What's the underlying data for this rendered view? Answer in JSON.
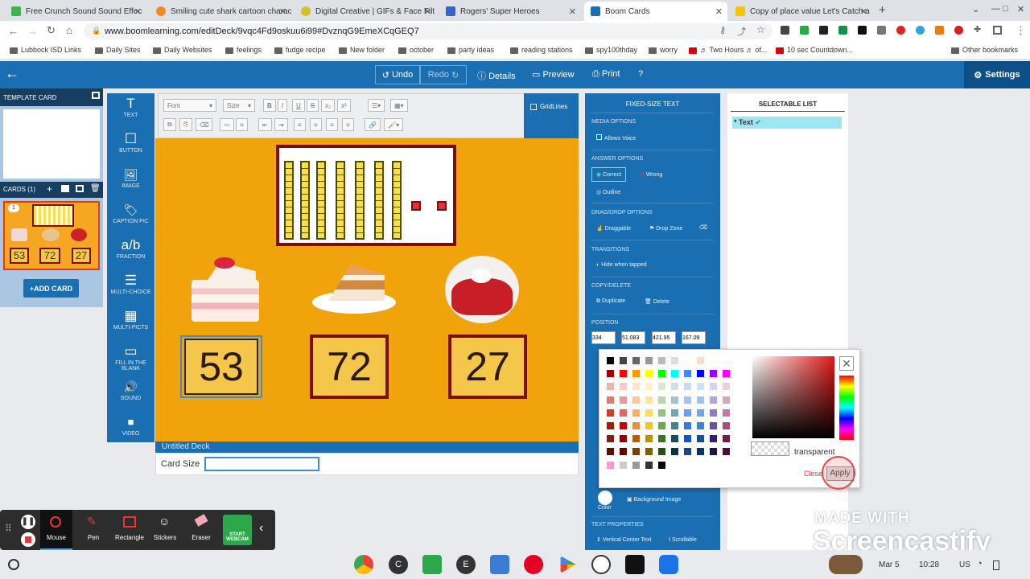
{
  "tabs": [
    {
      "title": "Free Crunch Sound Sound Effec",
      "color": "#3cb44a"
    },
    {
      "title": "Smiling cute shark cartoon charac",
      "color": "#f08a24"
    },
    {
      "title": "Digital Creative | GIFs & Face Filt",
      "color": "#d4c028"
    },
    {
      "title": "Rogers' Super Heroes",
      "color": "#3a63c8"
    },
    {
      "title": "Boom Cards",
      "color": "#1a6fb3"
    },
    {
      "title": "Copy of place value Let's Catch a",
      "color": "#f3c30e"
    }
  ],
  "url": "www.boomlearning.com/editDeck/9vqc4Fd9oskuu6i99#DvznqG9EmeXCqGEQ7",
  "bookmarks": [
    "Lubbock ISD Links",
    "Daily Sites",
    "Daily Websites",
    "feelings",
    "fudge recipe",
    "New folder",
    "october",
    "party ideas",
    "reading stations",
    "spy100thday",
    "worry",
    "♬ Two Hours ♬ of...",
    "10 sec Countdown...",
    "Other bookmarks"
  ],
  "header": {
    "undo": "Undo",
    "redo": "Redo",
    "details": "Details",
    "preview": "Preview",
    "print": "Print",
    "settings": "Settings"
  },
  "left": {
    "template_card": "TEMPLATE CARD",
    "cards": "CARDS (1)",
    "thumb_num": "1",
    "thumb_values": [
      "53",
      "72",
      "27"
    ],
    "add_card": "+ADD CARD"
  },
  "tools": [
    "TEXT",
    "BUTTON",
    "IMAGE",
    "CAPTION PIC",
    "FRACTION",
    "MULTI-CHOICE",
    "MULTI-PICTS",
    "FILL IN THE BLANK",
    "SOUND",
    "VIDEO"
  ],
  "tool_icons": [
    "T",
    "☐",
    "🖼",
    "🏷",
    "a/b",
    "☰",
    "▦",
    "▭",
    "🔊",
    "■"
  ],
  "editor": {
    "font": "Font",
    "size": "Size",
    "gridlines": "GridLines"
  },
  "card": {
    "values": [
      "53",
      "72",
      "27"
    ],
    "deck_name": "Untitled Deck",
    "card_size_label": "Card Size"
  },
  "props": {
    "title": "FIXED-SIZE TEXT",
    "media": "MEDIA OPTIONS",
    "allows_voice": "Allows Voice",
    "answer": "ANSWER OPTIONS",
    "correct": "Correct",
    "wrong": "Wrong",
    "outline": "Outline",
    "dragdrop": "DRAG/DROP OPTIONS",
    "draggable": "Draggable",
    "dropzone": "Drop Zone",
    "transitions": "TRANSITIONS",
    "hide": "Hide when tapped",
    "copydel": "COPY/DELETE",
    "duplicate": "Duplicate",
    "delete": "Delete",
    "position": "POSITION",
    "pos_values": [
      "334",
      "51.083",
      "421.95",
      "167.09"
    ],
    "background_label": "Background Image",
    "color_label": "Color",
    "text_props": "TEXT PROPERTIES",
    "vcenter": "Vertical Center Text",
    "scrollable": "Scrollable"
  },
  "selectable": {
    "title": "SELECTABLE LIST",
    "item": "* Text"
  },
  "picker": {
    "transparent": "transparent",
    "close": "Close",
    "apply": "Apply"
  },
  "screencastify": {
    "mouse": "Mouse",
    "pen": "Pen",
    "rect": "Rectangle",
    "stickers": "Stickers",
    "eraser": "Eraser",
    "webcam": "START WEBCAM",
    "made_with": "MADE WITH",
    "brand": "Screencastify"
  },
  "taskbar": {
    "date": "Mar 5",
    "time": "10:28",
    "locale": "US"
  }
}
